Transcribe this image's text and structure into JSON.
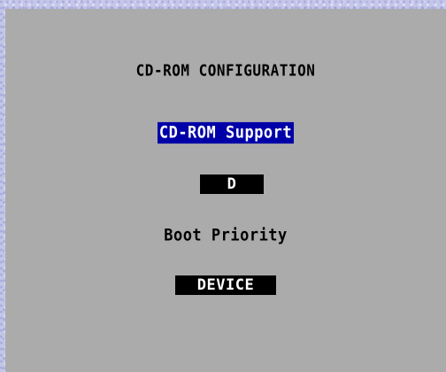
{
  "screen": {
    "title": "CD-ROM CONFIGURATION"
  },
  "items": [
    {
      "label": "CD-ROM Support",
      "value": "D",
      "selected": true
    },
    {
      "label": "Boot Priority",
      "value": "DEVICE",
      "selected": false
    }
  ],
  "colors": {
    "panel_background": "#ababab",
    "highlight_background": "#0000a8",
    "highlight_text": "#ffffff",
    "value_background": "#000000",
    "value_text": "#ffffff",
    "text": "#000000"
  }
}
